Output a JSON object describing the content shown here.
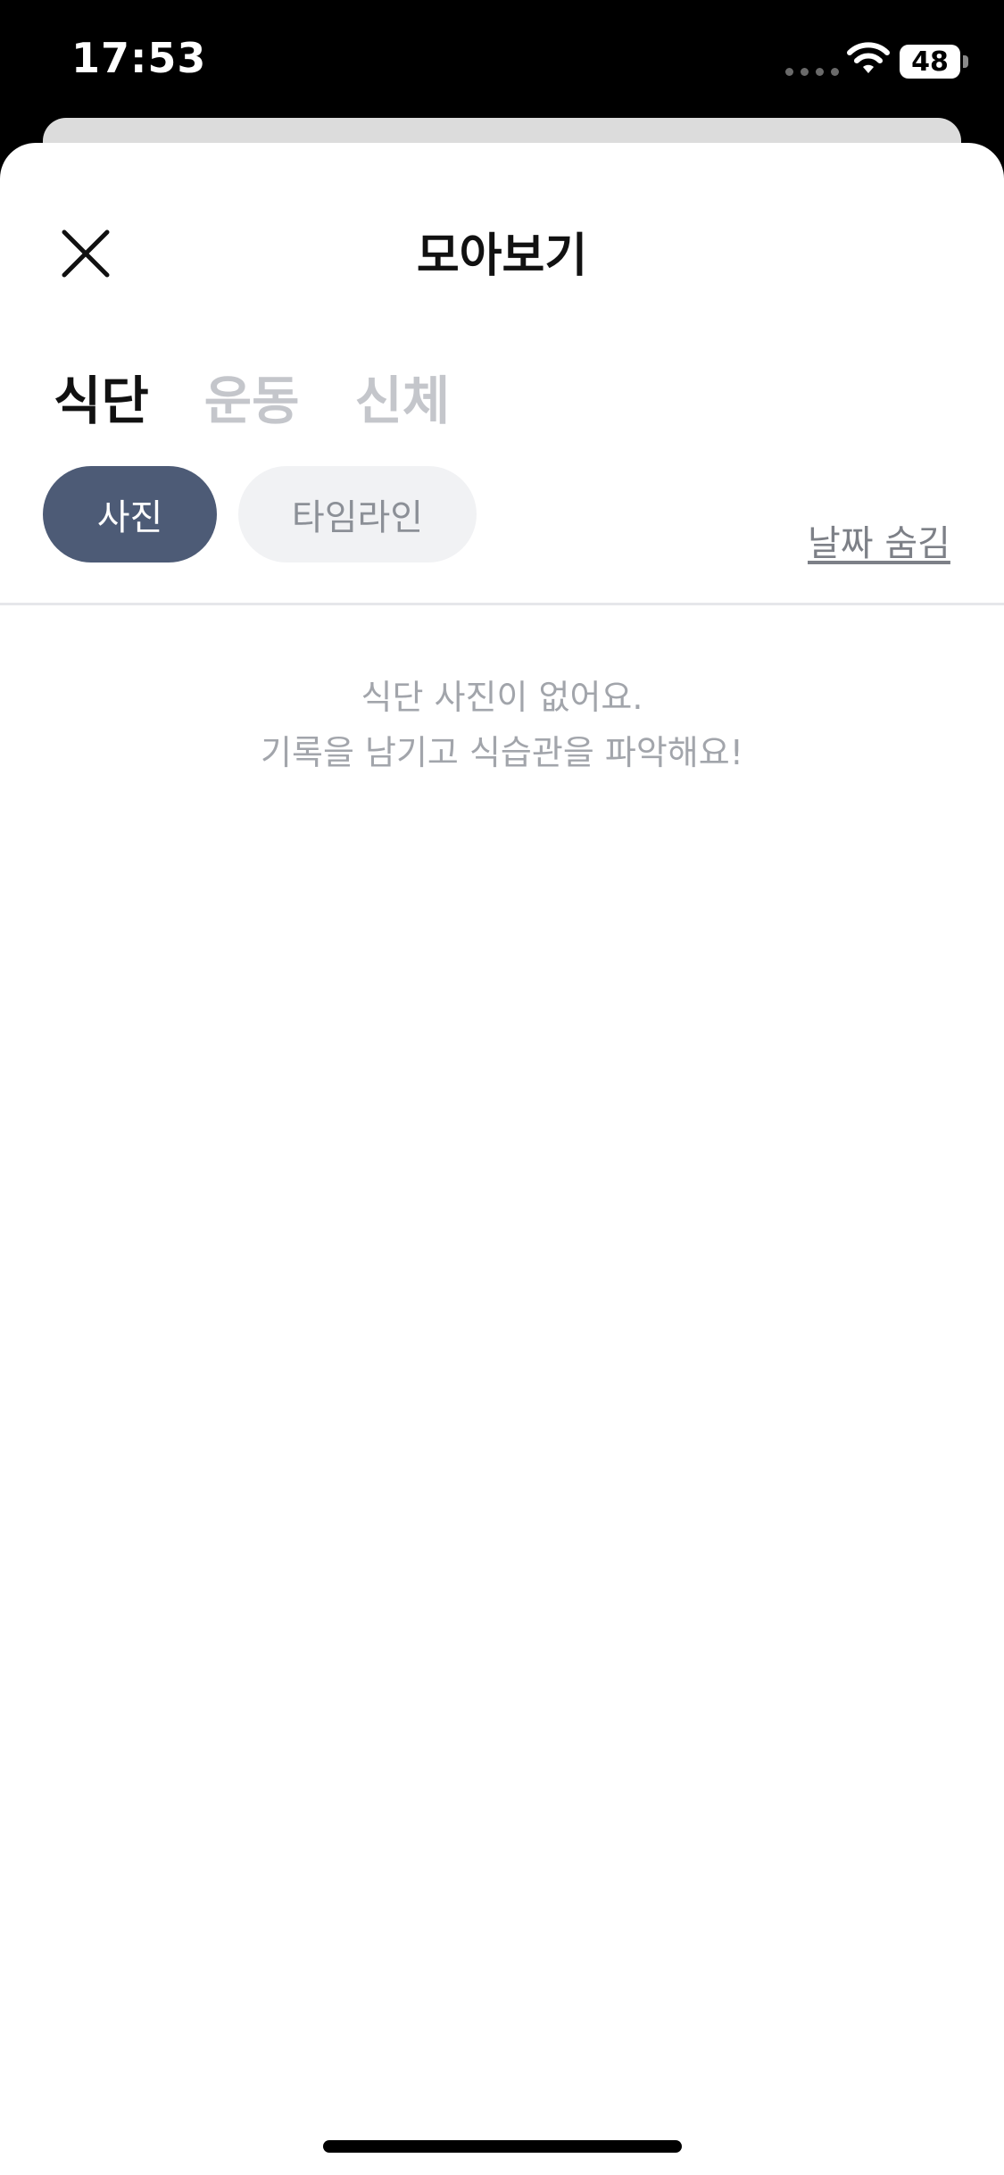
{
  "status_bar": {
    "time": "17:53",
    "battery": "48",
    "wifi_icon": "wifi-icon",
    "signal_icon": "signal-dots-icon"
  },
  "sheet": {
    "close_icon": "close-icon",
    "title": "모아보기"
  },
  "tabs": [
    {
      "label": "식단",
      "active": true
    },
    {
      "label": "운동",
      "active": false
    },
    {
      "label": "신체",
      "active": false
    }
  ],
  "view_chips": {
    "photo": "사진",
    "timeline": "타임라인",
    "selected": "사진"
  },
  "hide_dates_label": "날짜 숨김",
  "empty_state": {
    "line1": "식단 사진이 없어요.",
    "line2": "기록을 남기고 식습관을 파악해요!"
  },
  "colors": {
    "chip_active_bg": "#4d5b76",
    "chip_inactive_bg": "#f1f2f4",
    "tab_inactive": "#c4c6cb",
    "text_primary": "#111111"
  }
}
